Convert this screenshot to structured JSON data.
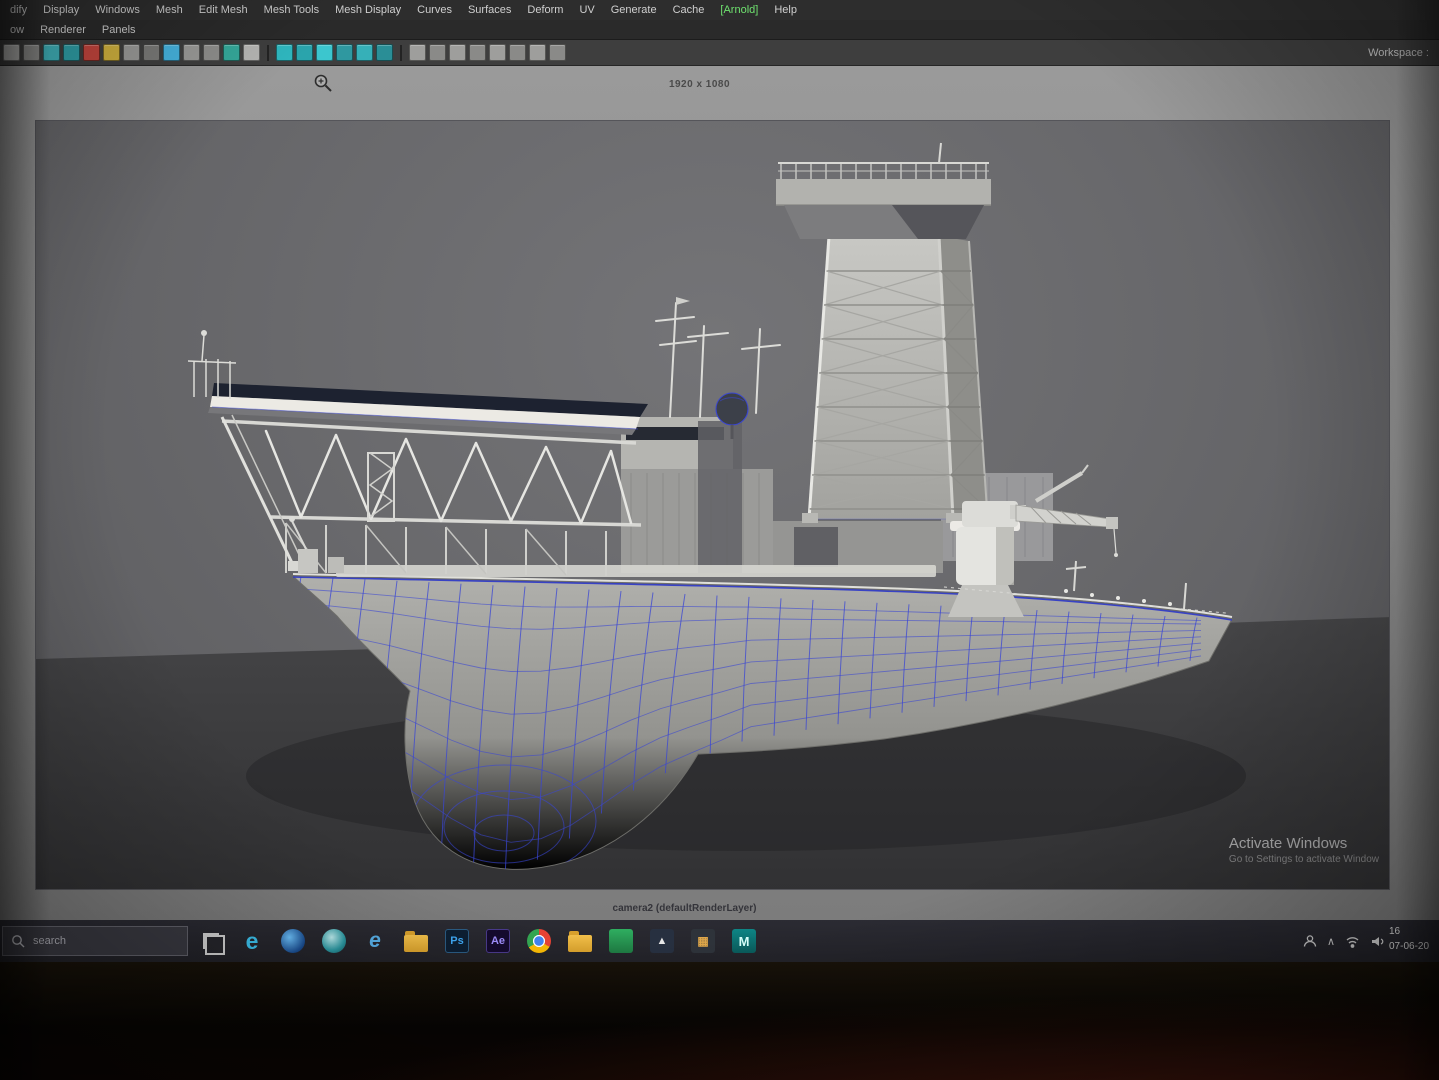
{
  "colors": {
    "wireframe_blue": "#3a46d4",
    "arnold_green": "#6fe26f",
    "viewport_gray": "#68686b",
    "taskbar_bg": "#26262e"
  },
  "menu_bar": {
    "items": [
      "dify",
      "Display",
      "Windows",
      "Mesh",
      "Edit Mesh",
      "Mesh Tools",
      "Mesh Display",
      "Curves",
      "Surfaces",
      "Deform",
      "UV",
      "Generate",
      "Cache",
      "[Arnold]",
      "Help"
    ]
  },
  "panel_bar": {
    "items": [
      "ow",
      "Renderer",
      "Panels"
    ]
  },
  "shelf": {
    "workspace_label": "Workspace :"
  },
  "render_view": {
    "resolution": "1920 x 1080",
    "camera_caption": "camera2 (defaultRenderLayer)"
  },
  "viewport": {
    "watermark_line1": "Activate Windows",
    "watermark_line2": "Go to Settings to activate Window"
  },
  "taskbar": {
    "search_placeholder": "search",
    "icons": [
      {
        "name": "task-view",
        "label": ""
      },
      {
        "name": "edge-browser",
        "label": "e"
      },
      {
        "name": "photos-app",
        "label": ""
      },
      {
        "name": "globe-app",
        "label": ""
      },
      {
        "name": "internet-explorer",
        "label": "e"
      },
      {
        "name": "file-explorer",
        "label": ""
      },
      {
        "name": "photoshop",
        "label": "Ps"
      },
      {
        "name": "after-effects",
        "label": "Ae"
      },
      {
        "name": "chrome-browser",
        "label": ""
      },
      {
        "name": "folder",
        "label": ""
      },
      {
        "name": "green-app",
        "label": ""
      },
      {
        "name": "media-app",
        "label": "▲"
      },
      {
        "name": "image-app",
        "label": "▦"
      },
      {
        "name": "maya",
        "label": "M"
      }
    ],
    "tray_time": "16",
    "tray_date": "07-06-20"
  }
}
